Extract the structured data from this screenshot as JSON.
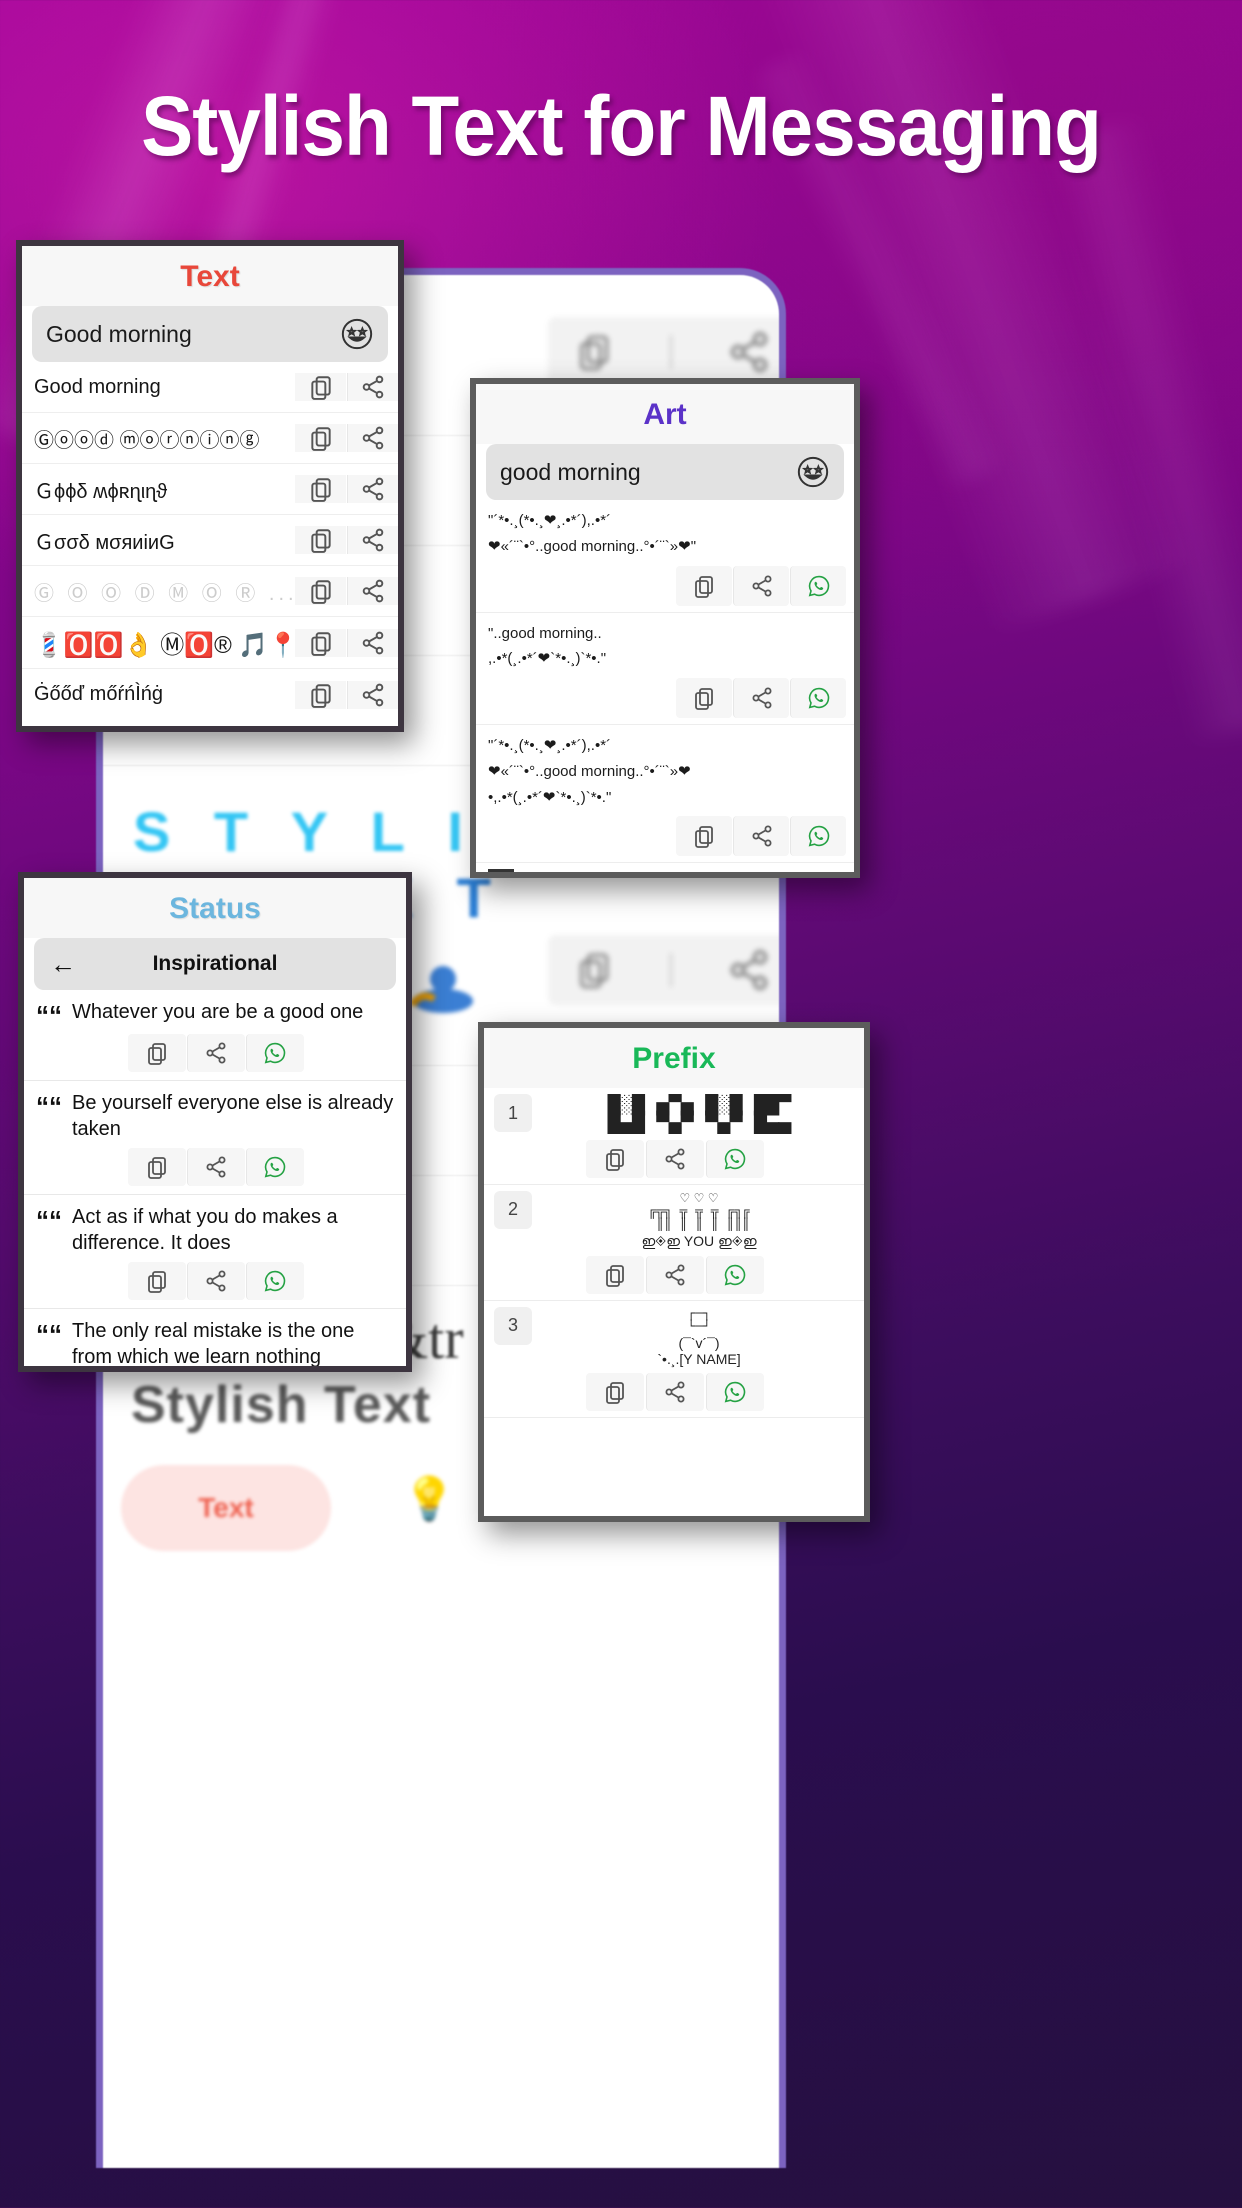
{
  "headline": "Stylish Text for Messaging",
  "background_phone": {
    "stylish_line1": "S T Y L I S",
    "stylish_line2": "H T E X T",
    "app_title": "Stylish Text",
    "pill_label": "Text",
    "amp_decor": "&tr"
  },
  "cards": {
    "text": {
      "title": "Text",
      "input": {
        "value": "Good  morning",
        "icon": "emoji-star-eyes-icon"
      },
      "rows": [
        {
          "text": "Good  morning"
        },
        {
          "text": "Ⓖⓞⓞⓓ  ⓜⓞⓡⓝⓘⓝⓖ"
        },
        {
          "text": "Ｇϕϕδ  ʍϕʀɳιɳϑ"
        },
        {
          "text": "Ｇσσδ  мσяиiиG"
        },
        {
          "text": "Ⓖ Ⓞ Ⓞ Ⓓ   Ⓜ Ⓞ Ⓡ ..."
        },
        {
          "text": "💈🅾️🅾️👌 Ⓜ🅾️® 🎵📍 ..."
        },
        {
          "text": "Ġőőď  mőŕńÌńġ"
        }
      ],
      "actions": [
        "copy-icon",
        "share-icon"
      ]
    },
    "art": {
      "title": "Art",
      "input": {
        "value": "good  morning",
        "icon": "emoji-star-eyes-icon"
      },
      "items": [
        {
          "line1": "\"´*•.¸(*•.¸❤¸.•*´),.•*´",
          "line2": "❤«´¨`•°..good  morning..°•´¨`»❤\""
        },
        {
          "line1": "\"..good  morning..",
          "line2": ",.•*(¸.•*´❤`*•.¸)`*•.\""
        },
        {
          "line1": "\"´*•.¸(*•.¸❤¸.•*´),.•*´",
          "line2": "❤«´¨`•°..good  morning..°•´¨`»❤",
          "line3": "•,.•*(¸.•*´❤`*•.¸)`*•.\""
        }
      ],
      "progress": "20%",
      "actions": [
        "copy-icon",
        "share-icon",
        "whatsapp-icon"
      ]
    },
    "status": {
      "title": "Status",
      "nav": {
        "back": "back-arrow-icon",
        "label": "Inspirational"
      },
      "quotes": [
        "Whatever you are be a good one",
        "Be yourself everyone else is already taken",
        "Act as if what you do makes a difference. It does",
        "The only real mistake is the one from which we learn nothing"
      ],
      "actions": [
        "copy-icon",
        "share-icon",
        "whatsapp-icon"
      ]
    },
    "prefix": {
      "title": "Prefix",
      "items": [
        {
          "num": "1",
          "art": "█░█ ▄▀▄ █░█ ██▀\n█▄█ ▀▄▀ ▀▄▀ █▄▄",
          "sub": ""
        },
        {
          "num": "2",
          "art": "╔╦╗ ╦ ╦ ╦ ╔╗╔\n ║║ ║ ║ ║ ║║║",
          "sub": "ഇ◈ഇ YOU ഇ◈ഇ",
          "hearts": "♡ ♡ ♡"
        },
        {
          "num": "3",
          "art": "┌─┐\n└─┘",
          "sub": "(¯`v´¯)\n`•.¸.[Y NAME]"
        }
      ],
      "actions": [
        "copy-icon",
        "share-icon",
        "whatsapp-icon"
      ]
    }
  },
  "colors": {
    "title_text": "#e8473a",
    "title_art": "#5b32c8",
    "title_status": "#6cb6de",
    "title_prefix": "#19b858",
    "whatsapp_green": "#25a244",
    "headline": "#ffffff"
  }
}
